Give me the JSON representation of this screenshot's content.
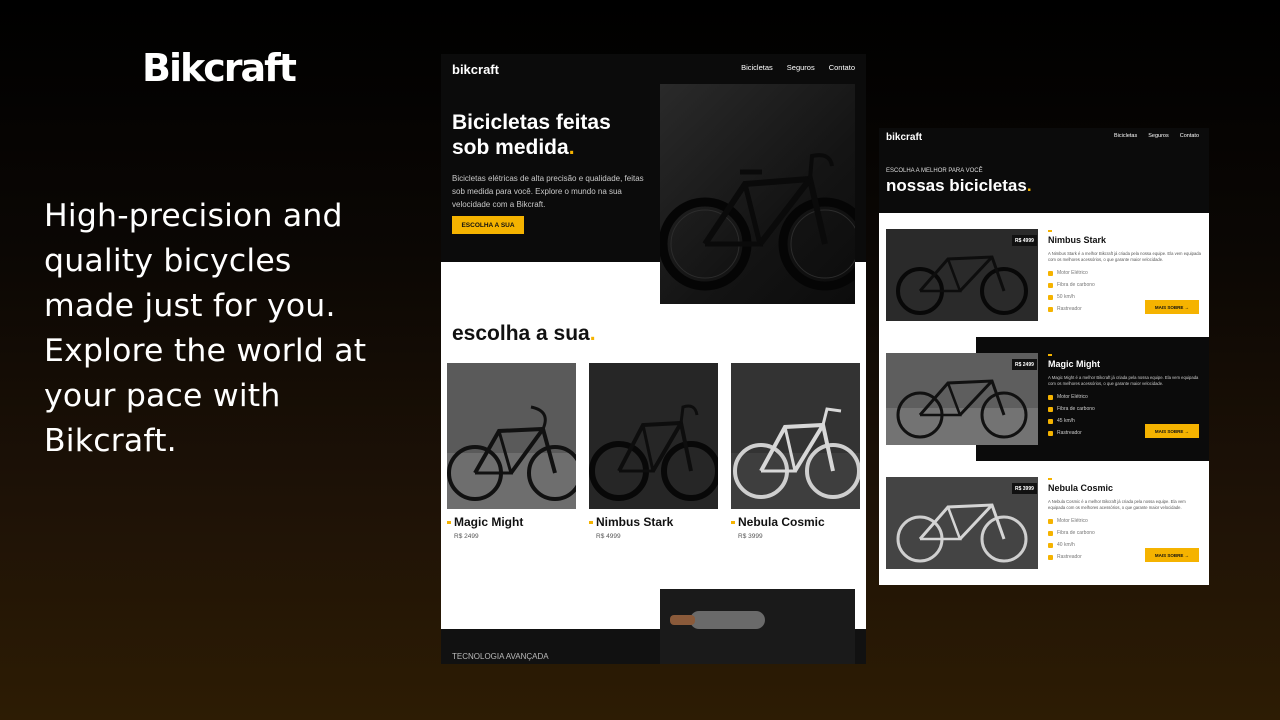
{
  "slide": {
    "brand": "Bikcraft",
    "tagline": "High-precision and quality bicycles made just for you. Explore the world at your pace with Bikcraft."
  },
  "home": {
    "logo": "bikcraft",
    "nav": [
      "Bicicletas",
      "Seguros",
      "Contato"
    ],
    "hero_title": "Bicicletas feitas sob medida",
    "hero_title_dot": ".",
    "hero_text": "Bicicletas elétricas de alta precisão e qualidade, feitas sob medida para você. Explore o mundo na sua velocidade com a Bikcraft.",
    "hero_button": "ESCOLHA A SUA",
    "section_title": "escolha a sua",
    "section_title_dot": ".",
    "products": [
      {
        "name": "Magic Might",
        "price": "R$ 2499"
      },
      {
        "name": "Nimbus Stark",
        "price": "R$ 4999"
      },
      {
        "name": "Nebula Cosmic",
        "price": "R$ 3999"
      }
    ],
    "footer_label": "TECNOLOGIA AVANÇADA"
  },
  "bikes_page": {
    "logo": "bikcraft",
    "nav": [
      "Bicicletas",
      "Seguros",
      "Contato"
    ],
    "subtitle": "ESCOLHA A MELHOR PARA VOCÊ",
    "title": "nossas bicicletas",
    "title_dot": ".",
    "bikes": [
      {
        "name": "Nimbus Stark",
        "price": "R$ 4999",
        "desc": "A Nimbus Stark é a melhor Bikcraft já criada pela nossa equipe. Ela vem equipada com os melhores acessórios, o que garante maior velocidade.",
        "features": [
          "Motor Elétrico",
          "Fibra de carbono",
          "50 km/h",
          "Rastreador"
        ],
        "button": "MAIS SOBRE →"
      },
      {
        "name": "Magic Might",
        "price": "R$ 2499",
        "desc": "A Magic Might é a melhor Bikcraft já criada pela nossa equipe. Ela vem equipada com os melhores acessórios, o que garante maior velocidade.",
        "features": [
          "Motor Elétrico",
          "Fibra de carbono",
          "45 km/h",
          "Rastreador"
        ],
        "button": "MAIS SOBRE →"
      },
      {
        "name": "Nebula Cosmic",
        "price": "R$ 3999",
        "desc": "A Nebula Cosmic é a melhor Bikcraft já criada pela nossa equipe. Ela vem equipada com os melhores acessórios, o que garante maior velocidade.",
        "features": [
          "Motor Elétrico",
          "Fibra de carbono",
          "40 km/h",
          "Rastreador"
        ],
        "button": "MAIS SOBRE →"
      }
    ]
  },
  "colors": {
    "accent": "#f5b300",
    "dark": "#0b0b0b",
    "light": "#ffffff"
  }
}
